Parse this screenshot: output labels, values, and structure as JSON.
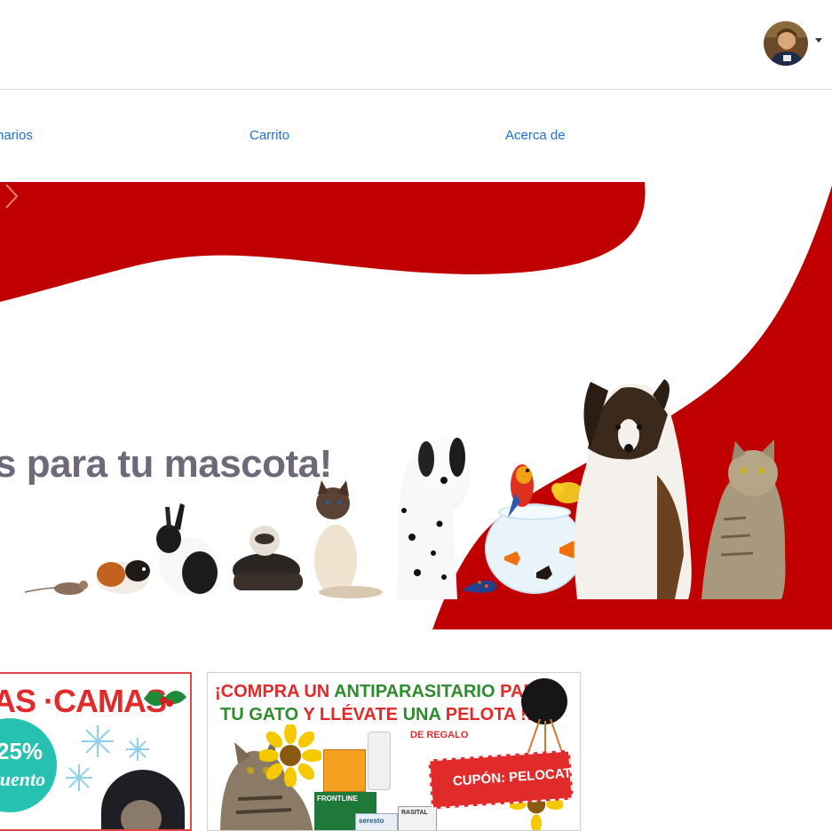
{
  "nav": {
    "items": [
      {
        "label": "narios"
      },
      {
        "label": "Carrito"
      },
      {
        "label": "Acerca de"
      }
    ]
  },
  "hero": {
    "headline": "s para tu mascota!"
  },
  "promos": [
    {
      "title": "AS ·CAMAS",
      "discount": "25%",
      "discount_sub": "cuento"
    },
    {
      "line1_a": "¡COMPRA UN ",
      "line1_b": "ANTIPARASITARIO",
      "line1_c": " PARA",
      "line2_a": "TU GATO ",
      "line2_b": "Y LLÉVATE",
      "line2_c": " UNA ",
      "line2_d": "PELOTA",
      "line2_e": " !!",
      "gift": "DE REGALO",
      "coupon": "CUPÓN: PELOCAT",
      "products": [
        "FRONTLINE",
        "seresto",
        "RASITAL"
      ]
    }
  ],
  "colors": {
    "link": "#1f6fd1",
    "brand_red": "#c00000",
    "headline": "#6e6878",
    "promo_red": "#e12b2b",
    "promo_green": "#2e8b2e"
  }
}
